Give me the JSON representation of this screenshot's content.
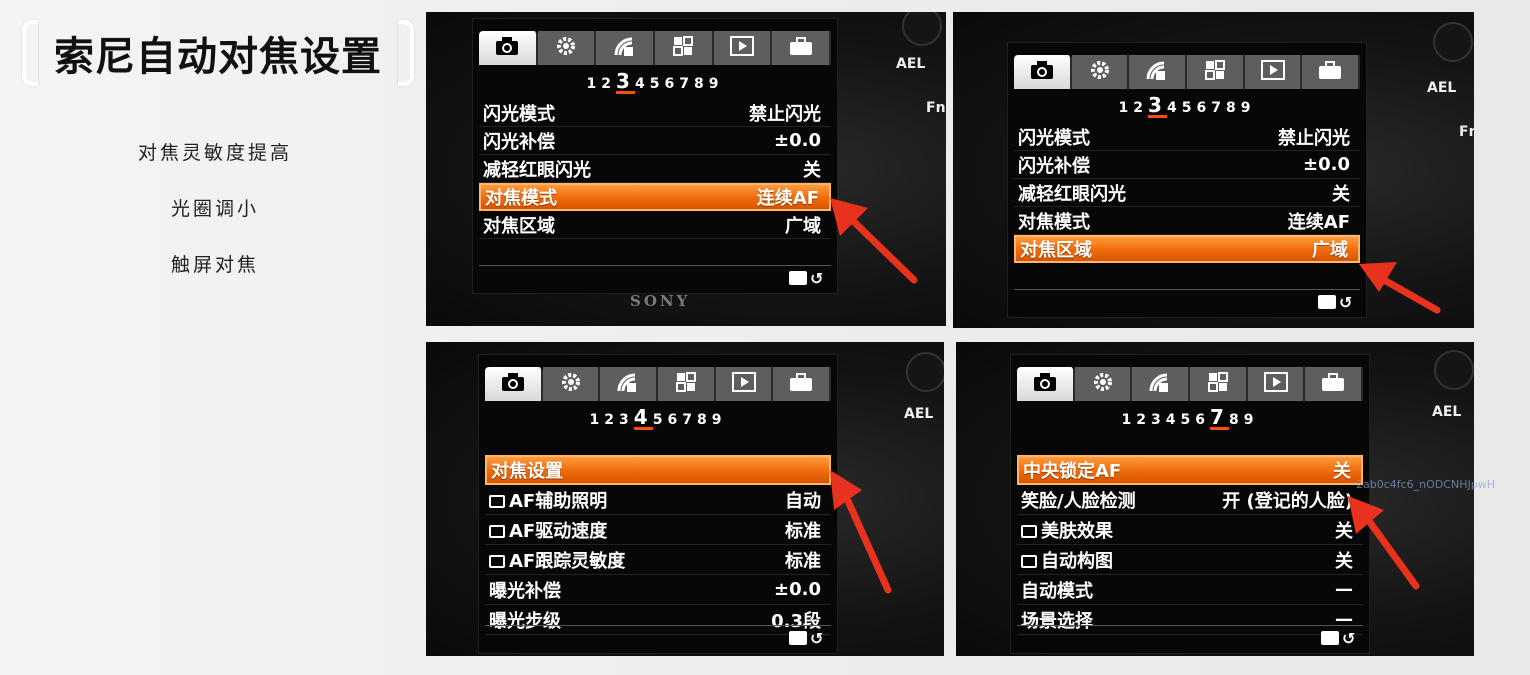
{
  "title": "索尼自动对焦设置",
  "tips": [
    "对焦灵敏度提高",
    "光圈调小",
    "触屏对焦"
  ],
  "camera": {
    "ael": "AEL",
    "fn": "Fn",
    "brand": "SONY"
  },
  "panels": [
    {
      "page_numbers": [
        "1",
        "2",
        "3",
        "4",
        "5",
        "6",
        "7",
        "8",
        "9"
      ],
      "current_page": "3",
      "rows": [
        {
          "label": "闪光模式",
          "value": "禁止闪光"
        },
        {
          "label": "闪光补偿",
          "value": "±0.0"
        },
        {
          "label": "减轻红眼闪光",
          "value": "关"
        },
        {
          "label": "对焦模式",
          "value": "连续AF",
          "selected": true
        },
        {
          "label": "对焦区域",
          "value": "广域"
        }
      ]
    },
    {
      "page_numbers": [
        "1",
        "2",
        "3",
        "4",
        "5",
        "6",
        "7",
        "8",
        "9"
      ],
      "current_page": "3",
      "rows": [
        {
          "label": "闪光模式",
          "value": "禁止闪光"
        },
        {
          "label": "闪光补偿",
          "value": "±0.0"
        },
        {
          "label": "减轻红眼闪光",
          "value": "关"
        },
        {
          "label": "对焦模式",
          "value": "连续AF"
        },
        {
          "label": "对焦区域",
          "value": "广域",
          "selected": true
        }
      ]
    },
    {
      "page_numbers": [
        "1",
        "2",
        "3",
        "4",
        "5",
        "6",
        "7",
        "8",
        "9"
      ],
      "current_page": "4",
      "rows": [
        {
          "label": "对焦设置",
          "value": "",
          "selected": true
        },
        {
          "label": "AF辅助照明",
          "value": "自动",
          "icon": true
        },
        {
          "label": "AF驱动速度",
          "value": "标准",
          "icon": true
        },
        {
          "label": "AF跟踪灵敏度",
          "value": "标准",
          "icon": true
        },
        {
          "label": "曝光补偿",
          "value": "±0.0"
        },
        {
          "label": "曝光步级",
          "value": "0.3段"
        }
      ]
    },
    {
      "page_numbers": [
        "1",
        "2",
        "3",
        "4",
        "5",
        "6",
        "7",
        "8",
        "9"
      ],
      "current_page": "7",
      "rows": [
        {
          "label": "中央锁定AF",
          "value": "关",
          "selected": true
        },
        {
          "label": "笑脸/人脸检测",
          "value": "开 (登记的人脸)"
        },
        {
          "label": "美肤效果",
          "value": "关",
          "icon": true
        },
        {
          "label": "自动构图",
          "value": "关",
          "icon": true
        },
        {
          "label": "自动模式",
          "value": "—"
        },
        {
          "label": "场景选择",
          "value": "—"
        }
      ]
    }
  ],
  "watermark": "2ab0c4fc6_nODCNHJpwH",
  "colors": {
    "accent": "#ef6a0a",
    "arrow": "#e8321e",
    "tab_inactive": "#5e5e5e"
  },
  "tab_icons": [
    "camera-icon",
    "gear-icon",
    "wifi-icon",
    "grid-icon",
    "play-icon",
    "toolbox-icon"
  ]
}
